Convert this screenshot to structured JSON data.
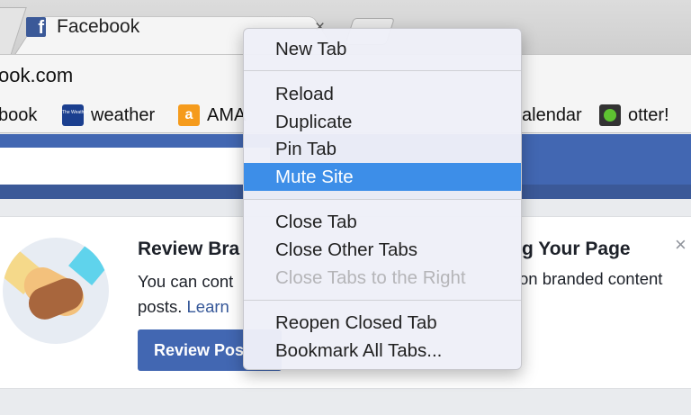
{
  "browser": {
    "active_tab_title": "Facebook",
    "tab_close_glyph": "×",
    "favicon_letter": "f",
    "url_fragment": "ook.com"
  },
  "bookmarks": [
    {
      "label": "book",
      "icon": null
    },
    {
      "label": "weather",
      "icon": "weather-channel-icon",
      "icon_text": "The Weather Channel"
    },
    {
      "label": "AMA",
      "icon": "amazon-icon",
      "icon_text": "a"
    },
    {
      "label": "alendar",
      "icon": null
    },
    {
      "label": "otter!",
      "icon": "otter-icon"
    }
  ],
  "context_menu": {
    "items": [
      {
        "label": "New Tab",
        "state": "normal"
      },
      {
        "label": "Reload",
        "state": "normal"
      },
      {
        "label": "Duplicate",
        "state": "normal"
      },
      {
        "label": "Pin Tab",
        "state": "normal"
      },
      {
        "label": "Mute Site",
        "state": "highlighted"
      },
      {
        "label": "Close Tab",
        "state": "normal"
      },
      {
        "label": "Close Other Tabs",
        "state": "normal"
      },
      {
        "label": "Close Tabs to the Right",
        "state": "disabled"
      },
      {
        "label": "Reopen Closed Tab",
        "state": "normal"
      },
      {
        "label": "Bookmark All Tabs...",
        "state": "normal"
      }
    ]
  },
  "card": {
    "title_left": "Review Bra",
    "title_right": "g Your Page",
    "body_line1_left": "You can cont",
    "body_line1_right": "on branded content",
    "body_line2_prefix": "posts.",
    "learn_more_fragment": "Learn",
    "button_label": "Review Pos",
    "close_glyph": "×"
  },
  "colors": {
    "facebook_blue": "#4267b2",
    "menu_highlight": "#3d8ee8",
    "link": "#365899"
  }
}
